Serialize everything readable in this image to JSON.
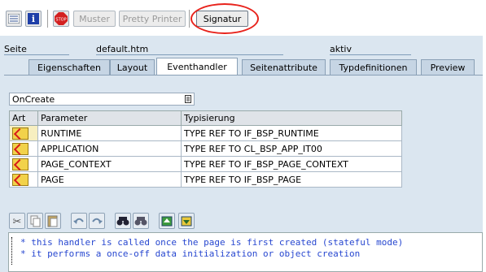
{
  "toolbar": {
    "muster_label": "Muster",
    "pretty_printer_label": "Pretty Printer",
    "signatur_label": "Signatur"
  },
  "page": {
    "seite_label": "Seite",
    "seite_value": "default.htm",
    "status": "aktiv"
  },
  "tabs": [
    {
      "label": "Eigenschaften"
    },
    {
      "label": "Layout"
    },
    {
      "label": "Eventhandler"
    },
    {
      "label": "Seitenattribute"
    },
    {
      "label": "Typdefinitionen"
    },
    {
      "label": "Preview"
    }
  ],
  "event_select": {
    "value": "OnCreate"
  },
  "params_table": {
    "headers": [
      "Art",
      "Parameter",
      "Typisierung"
    ],
    "rows": [
      {
        "parameter": "RUNTIME",
        "typisierung": "TYPE REF TO IF_BSP_RUNTIME"
      },
      {
        "parameter": "APPLICATION",
        "typisierung": "TYPE REF TO CL_BSP_APP_IT00"
      },
      {
        "parameter": "PAGE_CONTEXT",
        "typisierung": "TYPE REF TO IF_BSP_PAGE_CONTEXT"
      },
      {
        "parameter": "PAGE",
        "typisierung": "TYPE REF TO IF_BSP_PAGE"
      }
    ]
  },
  "editor": {
    "lines": [
      "* this handler is called once the page is first created (stateful mode)",
      "* it performs a once-off data initialization or object creation"
    ]
  },
  "colors": {
    "panel_bg": "#dbe6f0",
    "highlight_circle": "#e8231c",
    "comment_text": "#2747d0"
  }
}
